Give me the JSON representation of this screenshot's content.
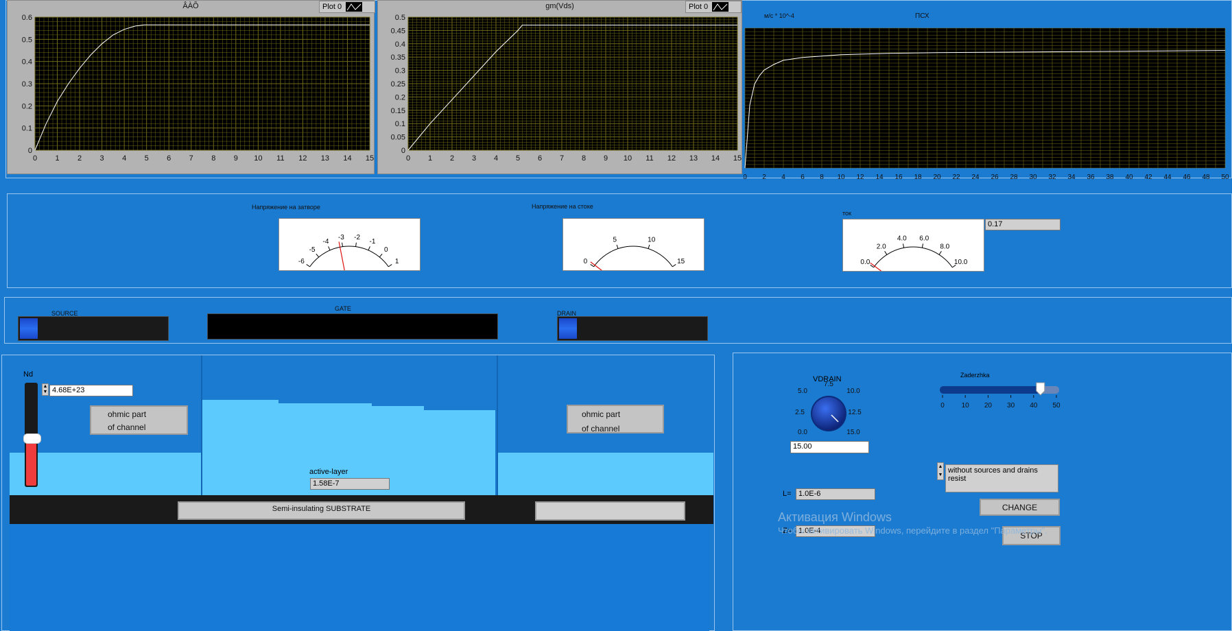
{
  "graph1": {
    "title": "ÂÀÕ",
    "legend": "Plot 0",
    "xticks": [
      "0",
      "1",
      "2",
      "3",
      "4",
      "5",
      "6",
      "7",
      "8",
      "9",
      "10",
      "11",
      "12",
      "13",
      "14",
      "15"
    ],
    "yticks": [
      "0",
      "0.1",
      "0.2",
      "0.3",
      "0.4",
      "0.5",
      "0.6"
    ]
  },
  "graph2": {
    "title": "gm(Vds)",
    "legend": "Plot 0",
    "xticks": [
      "0",
      "1",
      "2",
      "3",
      "4",
      "5",
      "6",
      "7",
      "8",
      "9",
      "10",
      "11",
      "12",
      "13",
      "14",
      "15"
    ],
    "yticks": [
      "0",
      "0.05",
      "0.1",
      "0.15",
      "0.2",
      "0.25",
      "0.3",
      "0.35",
      "0.4",
      "0.45",
      "0.5"
    ]
  },
  "graph3": {
    "title": "ПСХ",
    "units": "м/с * 10^-4",
    "xticks": [
      "0",
      "2",
      "4",
      "6",
      "8",
      "10",
      "12",
      "14",
      "16",
      "18",
      "20",
      "22",
      "24",
      "26",
      "28",
      "30",
      "32",
      "34",
      "36",
      "38",
      "40",
      "42",
      "44",
      "46",
      "48",
      "50"
    ]
  },
  "meters": {
    "gate": {
      "label": "Напряжение на затворе",
      "ticks": [
        "-6",
        "-5",
        "-4",
        "-3",
        "-2",
        "-1",
        "0",
        "1"
      ],
      "value": -3.2
    },
    "drain": {
      "label": "Напряжение на стоке",
      "ticks": [
        "0",
        "5",
        "10",
        "15"
      ],
      "value": 0.3
    },
    "current": {
      "label": "ток",
      "ticks": [
        "0.0",
        "2.0",
        "4.0",
        "6.0",
        "8.0",
        "10.0"
      ],
      "value": 0.17,
      "readout": "0.17"
    }
  },
  "electrodes": {
    "source": "SOURCE",
    "gate": "GATE",
    "drain": "DRAIN"
  },
  "device": {
    "nd_label": "Nd",
    "nd_value": "4.68E+23",
    "ohmic_left_line1": "ohmic part",
    "ohmic_left_line2": "of channel",
    "ohmic_right_line1": "ohmic part",
    "ohmic_right_line2": "of channel",
    "active_label": "active-layer",
    "active_value": "1.58E-7",
    "substrate_label": "Semi-insulating SUBSTRATE",
    "substrate_right": ""
  },
  "controls": {
    "vdrain_label": "VDRAIN",
    "vdrain_ticks": [
      "0.0",
      "2.5",
      "5.0",
      "7.5",
      "10.0",
      "12.5",
      "15.0"
    ],
    "vdrain_value": "15.00",
    "zaderzhka_label": "Zaderzhka",
    "zaderzhka_ticks": [
      "0",
      "10",
      "20",
      "30",
      "40",
      "50"
    ],
    "zaderzhka_value": 43,
    "mode_text": "without sources and drains resist",
    "l_label": "L=",
    "l_value": "1.0E-6",
    "z_label": "Z=",
    "z_value": "1.0E-4",
    "change_label": "CHANGE",
    "stop_label": "STOP"
  },
  "watermark": {
    "line1": "Активация Windows",
    "line2": "Чтобы активировать Windows, перейдите в раздел \"Параметры\"."
  },
  "chart_data": [
    {
      "type": "line",
      "title": "ÂÀÕ",
      "xlim": [
        0,
        15
      ],
      "ylim": [
        0,
        0.6
      ],
      "x": [
        0,
        0.5,
        1,
        1.5,
        2,
        2.5,
        3,
        3.5,
        4,
        4.5,
        4.9,
        5,
        6,
        8,
        10,
        12,
        14,
        15
      ],
      "y": [
        0,
        0.12,
        0.22,
        0.3,
        0.37,
        0.43,
        0.48,
        0.52,
        0.545,
        0.56,
        0.565,
        0.565,
        0.565,
        0.565,
        0.565,
        0.565,
        0.565,
        0.565
      ]
    },
    {
      "type": "line",
      "title": "gm(Vds)",
      "xlim": [
        0,
        15
      ],
      "ylim": [
        0,
        0.5
      ],
      "x": [
        0,
        1,
        2,
        3,
        4,
        5,
        5.2,
        6,
        8,
        10,
        12,
        14,
        15
      ],
      "y": [
        0,
        0.1,
        0.19,
        0.28,
        0.37,
        0.45,
        0.47,
        0.47,
        0.47,
        0.47,
        0.47,
        0.47,
        0.47
      ]
    },
    {
      "type": "line",
      "title": "ПСХ",
      "xlim": [
        0,
        50
      ],
      "x": [
        0,
        0.5,
        1,
        1.5,
        2,
        3,
        4,
        6,
        8,
        10,
        15,
        20,
        30,
        40,
        50
      ],
      "y": [
        0,
        0.45,
        0.6,
        0.66,
        0.7,
        0.74,
        0.77,
        0.79,
        0.8,
        0.81,
        0.82,
        0.825,
        0.83,
        0.835,
        0.84
      ]
    }
  ]
}
